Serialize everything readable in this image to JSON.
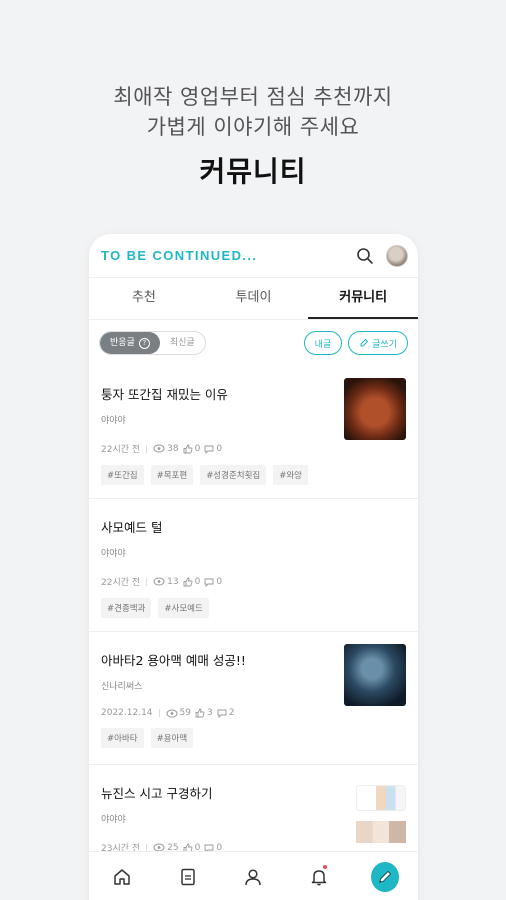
{
  "promo": {
    "line1": "최애작 영업부터 점심 추천까지",
    "line2": "가볍게 이야기해 주세요",
    "title": "커뮤니티"
  },
  "header": {
    "brand": "TO BE CONTINUED..."
  },
  "tabs": [
    {
      "label": "추천"
    },
    {
      "label": "투데이"
    },
    {
      "label": "커뮤니티"
    }
  ],
  "filters": {
    "sort_popular": "반응글",
    "sort_recent": "최신글",
    "mine": "내글",
    "write": "글쓰기"
  },
  "posts": [
    {
      "title": "퉁자 또간집 재밌는 이유",
      "author": "야야야",
      "time": "22시간 전",
      "views": "38",
      "likes": "0",
      "comments": "0",
      "tags": [
        "#또간집",
        "#목포편",
        "#성경준치횟집",
        "#와앙"
      ]
    },
    {
      "title": "사모예드 털",
      "author": "야야야",
      "time": "22시간 전",
      "views": "13",
      "likes": "0",
      "comments": "0",
      "tags": [
        "#견종백과",
        "#사모예드"
      ]
    },
    {
      "title": "아바타2 용아맥 예매 성공!!",
      "author": "신나리써스",
      "time": "2022.12.14",
      "views": "59",
      "likes": "3",
      "comments": "2",
      "tags": [
        "#아바타",
        "#용아맥"
      ]
    },
    {
      "title": "뉴진스 시고 구경하기",
      "author": "야야야",
      "time": "23시간 전",
      "views": "25",
      "likes": "0",
      "comments": "0",
      "tags": []
    }
  ],
  "colors": {
    "accent": "#1fb7c6",
    "background": "#f2f3f5"
  }
}
